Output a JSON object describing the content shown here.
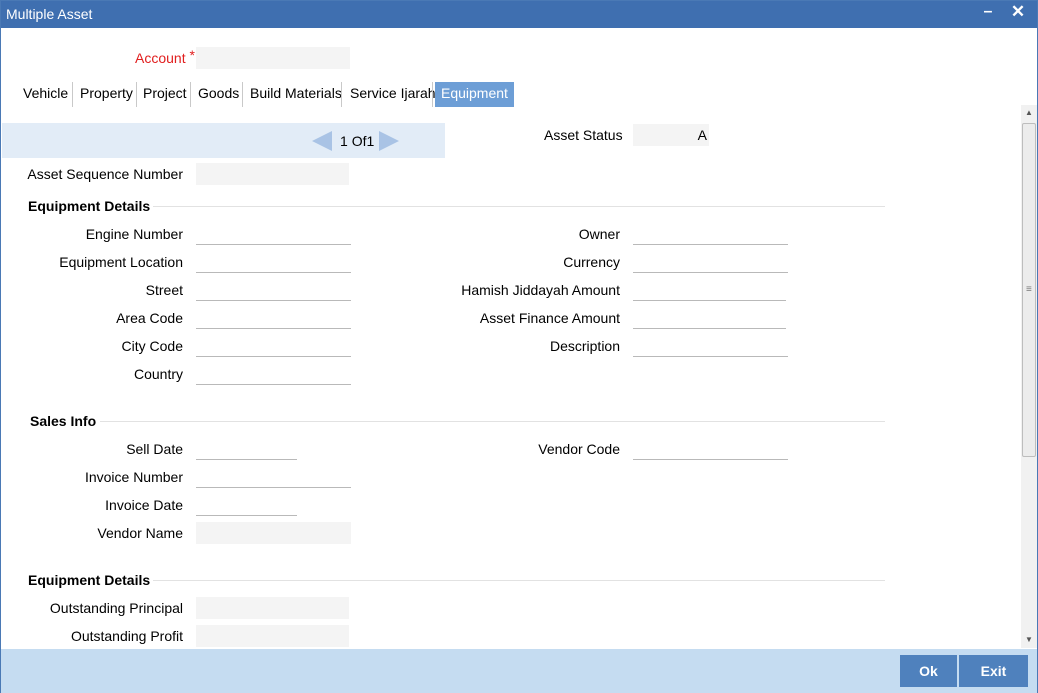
{
  "window": {
    "title": "Multiple Asset"
  },
  "account": {
    "label": "Account",
    "required_marker": "*",
    "value": ""
  },
  "tabs": [
    {
      "label": "Vehicle"
    },
    {
      "label": "Property"
    },
    {
      "label": "Project"
    },
    {
      "label": "Goods"
    },
    {
      "label": "Build Materials"
    },
    {
      "label": "Service Ijarah"
    },
    {
      "label": "Equipment",
      "active": true
    }
  ],
  "pager": {
    "current": "1",
    "of_label": "Of",
    "total": "1"
  },
  "asset_status": {
    "label": "Asset Status",
    "value": "A"
  },
  "asset_sequence": {
    "label": "Asset Sequence Number",
    "value": ""
  },
  "equipment_details": {
    "heading": "Equipment Details",
    "left": [
      {
        "label": "Engine Number",
        "value": ""
      },
      {
        "label": "Equipment Location",
        "value": ""
      },
      {
        "label": "Street",
        "value": ""
      },
      {
        "label": "Area Code",
        "value": ""
      },
      {
        "label": "City Code",
        "value": ""
      },
      {
        "label": "Country",
        "value": ""
      }
    ],
    "right": [
      {
        "label": "Owner",
        "value": ""
      },
      {
        "label": "Currency",
        "value": ""
      },
      {
        "label": "Hamish Jiddayah Amount",
        "value": ""
      },
      {
        "label": "Asset Finance Amount",
        "value": ""
      },
      {
        "label": "Description",
        "value": ""
      }
    ]
  },
  "sales_info": {
    "heading": "Sales Info",
    "left": [
      {
        "label": "Sell Date",
        "value": ""
      },
      {
        "label": "Invoice Number",
        "value": ""
      },
      {
        "label": "Invoice Date",
        "value": ""
      },
      {
        "label": "Vendor Name",
        "value": ""
      }
    ],
    "right": [
      {
        "label": "Vendor Code",
        "value": ""
      }
    ]
  },
  "equipment_details_2": {
    "heading": "Equipment Details",
    "fields": [
      {
        "label": "Outstanding Principal",
        "value": ""
      },
      {
        "label": "Outstanding Profit",
        "value": ""
      }
    ]
  },
  "footer": {
    "ok_label": "Ok",
    "exit_label": "Exit"
  },
  "colors": {
    "title_bar": "#3f6fb0",
    "active_tab": "#6d9ed6",
    "button": "#4f81bd",
    "footer": "#c5dcf1",
    "required": "#e11f1f"
  }
}
